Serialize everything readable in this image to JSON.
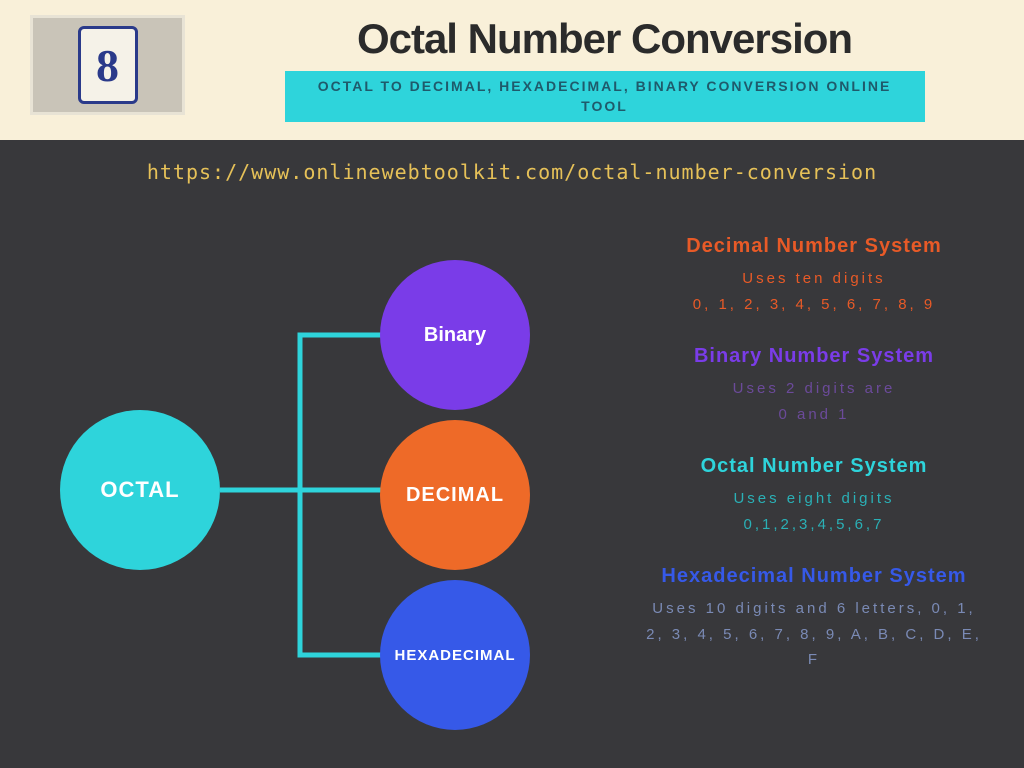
{
  "header": {
    "tile_digit": "8",
    "title": "Octal Number Conversion",
    "subtitle": "OCTAL TO DECIMAL, HEXADECIMAL, BINARY CONVERSION ONLINE TOOL"
  },
  "url": "https://www.onlinewebtoolkit.com/octal-number-conversion",
  "diagram": {
    "root": "OCTAL",
    "branches": {
      "binary": "Binary",
      "decimal": "DECIMAL",
      "hex": "HEXADECIMAL"
    }
  },
  "info": {
    "decimal": {
      "title": "Decimal Number System",
      "line1": "Uses ten digits",
      "line2": "0, 1, 2, 3, 4, 5, 6, 7, 8, 9"
    },
    "binary": {
      "title": "Binary Number System",
      "line1": "Uses 2 digits are",
      "line2": "0 and 1"
    },
    "octal": {
      "title": "Octal Number System",
      "line1": "Uses eight digits",
      "line2": "0,1,2,3,4,5,6,7"
    },
    "hex": {
      "title": "Hexadecimal Number System",
      "line1": "Uses 10 digits and 6 letters, 0, 1, 2, 3, 4, 5, 6, 7, 8, 9, A, B, C, D, E, F"
    }
  }
}
